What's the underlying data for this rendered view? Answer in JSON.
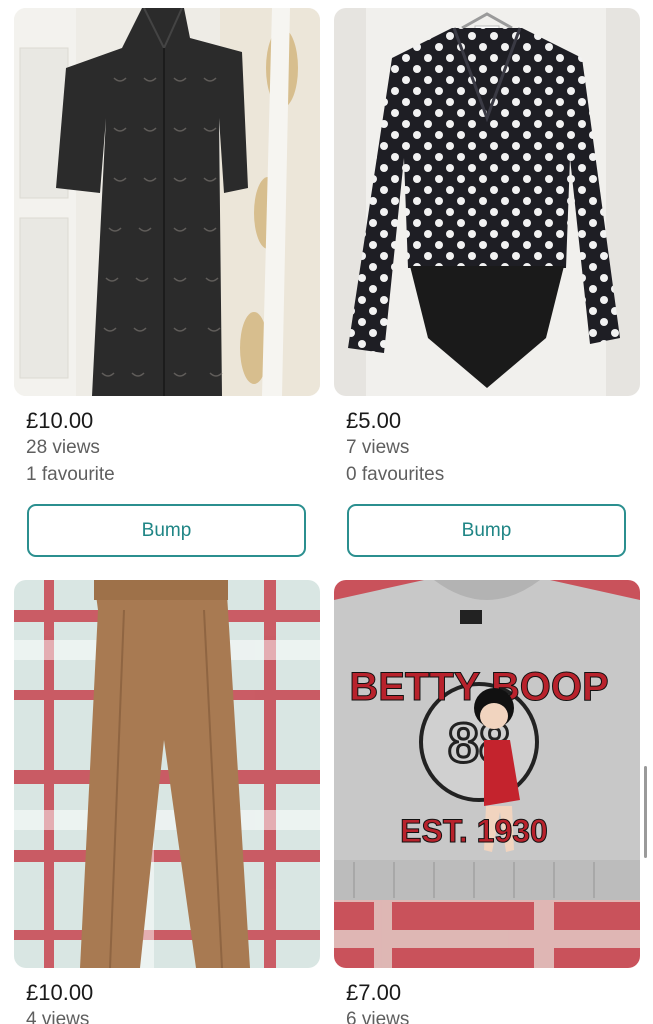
{
  "listings": [
    {
      "price": "£10.00",
      "views": "28 views",
      "favourites": "1 favourite",
      "button_label": "Bump",
      "photo": "photo-dress"
    },
    {
      "price": "£5.00",
      "views": "7 views",
      "favourites": "0 favourites",
      "button_label": "Bump",
      "photo": "photo-polka-bodysuit"
    },
    {
      "price": "£10.00",
      "views": "4 views",
      "photo": "photo-trousers"
    },
    {
      "price": "£7.00",
      "views": "6 views",
      "photo": "photo-betty-boop-sweatshirt"
    }
  ],
  "print_text": {
    "brand_line1": "BETTY BOOP",
    "number": "88",
    "est": "EST. 1930"
  },
  "colors": {
    "accent": "#2b8f8f",
    "price_text": "#1a1a1a",
    "meta_text": "#5f5f5f"
  }
}
